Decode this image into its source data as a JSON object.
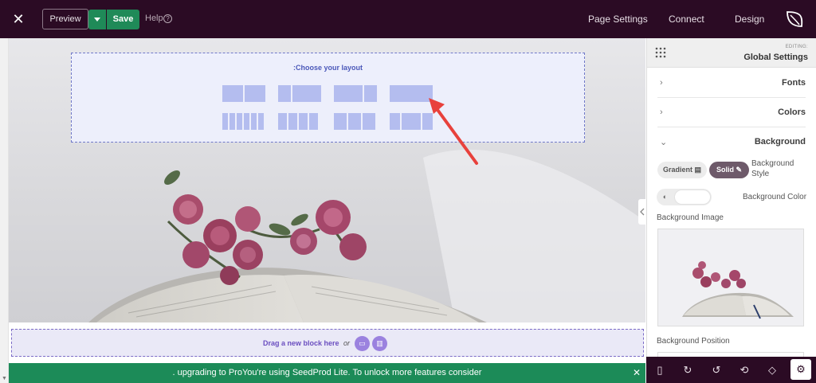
{
  "topbar": {
    "preview_label": "Preview",
    "save_label": "Save",
    "help_label": "Help",
    "help_icon": "?",
    "links": [
      "Page Settings",
      "Connect",
      "Design"
    ]
  },
  "canvas": {
    "layout_title": ":Choose your layout",
    "drag_text": "Drag a new block here",
    "or_text": "or"
  },
  "notice": {
    "text": ". upgrading to ProYou're using SeedProd Lite. To unlock more features consider"
  },
  "panel": {
    "editing_label": "EDITING:",
    "title": "Global Settings",
    "sections": [
      {
        "label": "Fonts",
        "expanded": false
      },
      {
        "label": "Colors",
        "expanded": false
      },
      {
        "label": "Background",
        "expanded": true
      }
    ],
    "gradient_label": "Gradient",
    "solid_label": "Solid",
    "background_style_label": "Background Style",
    "background_color_label": "Background Color",
    "background_image_label": "Background Image",
    "background_position_label": "Background Position"
  },
  "colors": {
    "topbar": "#2b0b24",
    "save_green": "#1f8a58",
    "layout_blue": "#b4bdef",
    "arrow_red": "#e8413c",
    "solid_active": "#6e5a6a"
  }
}
